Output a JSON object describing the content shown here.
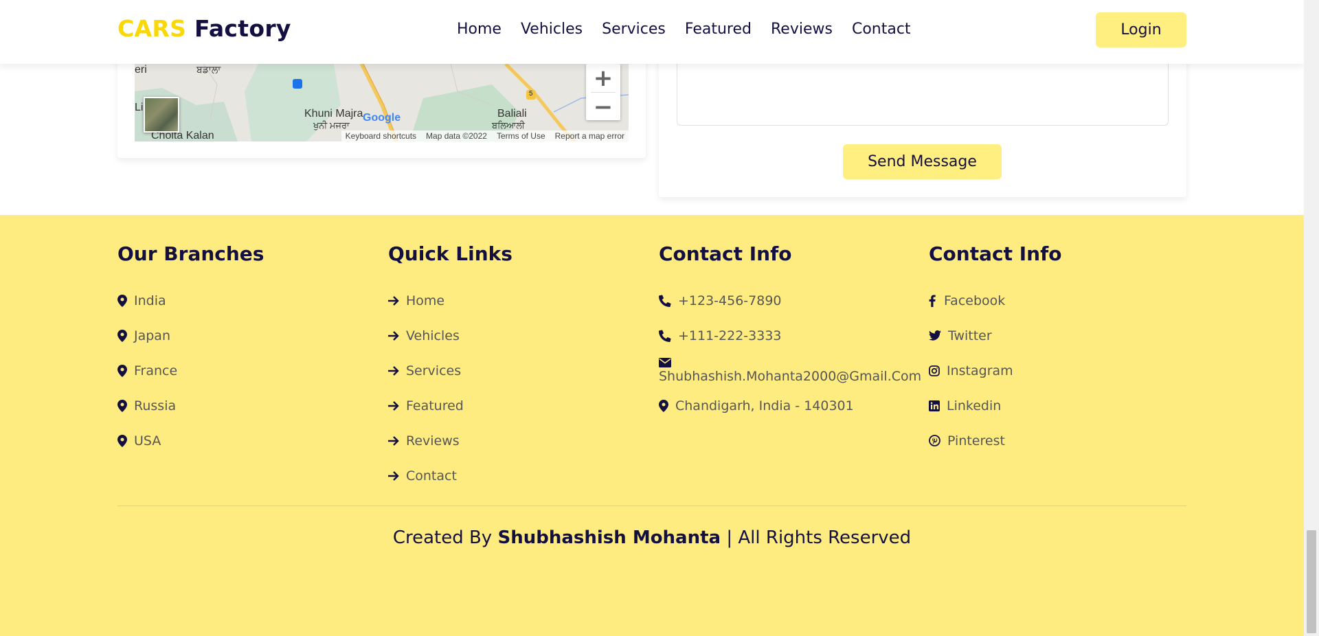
{
  "header": {
    "logo_accent": "CARS",
    "logo_main": "Factory",
    "nav": [
      "Home",
      "Vehicles",
      "Services",
      "Featured",
      "Reviews",
      "Contact"
    ],
    "login_label": "Login"
  },
  "map": {
    "labels": {
      "eri": "eri",
      "badala": "ਬਡਾਲਾ",
      "khuni": "Khuni Majra",
      "khuni_pa": "ਖੁਨੀ ਮਜਰਾ",
      "baliali": "Baliali",
      "baliali_pa": "ਬਲਿਆਲੀ",
      "cholta": "Cholta Kalan",
      "li": "Li",
      "route": "5",
      "google": "Google"
    },
    "attribution": [
      "Keyboard shortcuts",
      "Map data ©2022",
      "Terms of Use",
      "Report a map error"
    ],
    "zoom_in": "+",
    "zoom_out": "−"
  },
  "form": {
    "send_label": "Send Message"
  },
  "footer": {
    "branches": {
      "title": "Our Branches",
      "items": [
        "India",
        "Japan",
        "France",
        "Russia",
        "USA"
      ]
    },
    "quick_links": {
      "title": "Quick Links",
      "items": [
        "Home",
        "Vehicles",
        "Services",
        "Featured",
        "Reviews",
        "Contact"
      ]
    },
    "contact": {
      "title": "Contact Info",
      "phone1": "+123-456-7890",
      "phone2": "+111-222-3333",
      "email": "Shubhashish.Mohanta2000@Gmail.Com",
      "address": "Chandigarh, India - 140301"
    },
    "social": {
      "title": "Contact Info",
      "items": [
        "Facebook",
        "Twitter",
        "Instagram",
        "Linkedin",
        "Pinterest"
      ]
    },
    "credit": {
      "prefix": "Created By",
      "author": "Shubhashish Mohanta",
      "suffix": "| All Rights Reserved"
    }
  },
  "colors": {
    "accent": "#f9d806",
    "button": "#ffee80",
    "footer_bg": "#ffec80",
    "text_dark": "#130f40"
  }
}
